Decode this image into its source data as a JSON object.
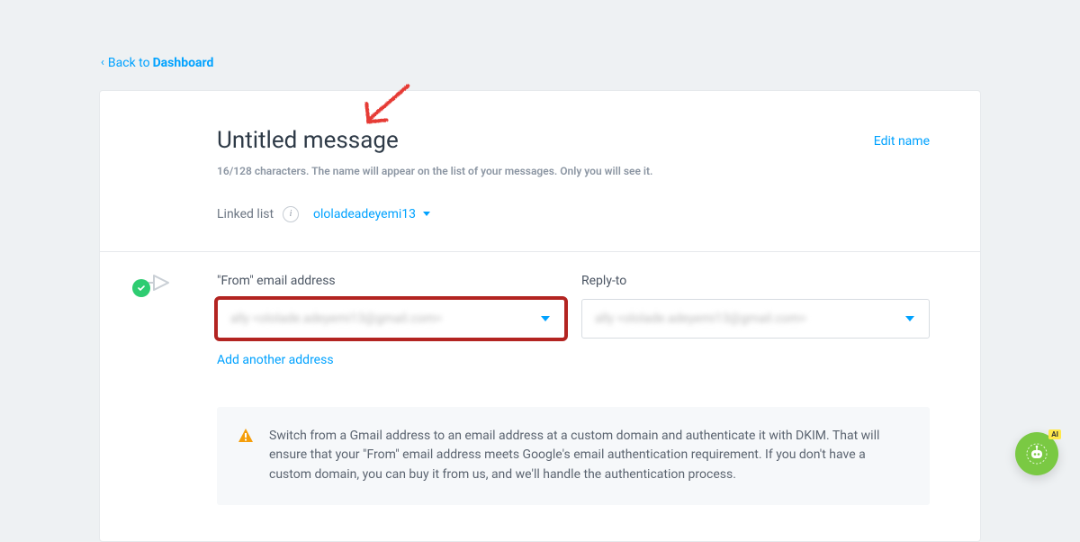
{
  "back": {
    "prefix": "Back to",
    "target": "Dashboard"
  },
  "header": {
    "title": "Untitled message",
    "subtitle": "16/128 characters. The name will appear on the list of your messages. Only you will see it.",
    "edit_name": "Edit name",
    "linked_label": "Linked list",
    "linked_value": "ololadeadeyemi13"
  },
  "fields": {
    "from_label": "\"From\" email address",
    "from_value": "ally <ololade.adeyemi13@gmail.com>",
    "replyto_label": "Reply-to",
    "replyto_value": "ally <ololade.adeyemi13@gmail.com>",
    "add_address": "Add another address"
  },
  "notice": {
    "text": "Switch from a Gmail address to an email address at a custom domain and authenticate it with DKIM. That will ensure that your \"From\" email address meets Google's email authentication requirement. If you don't have a custom domain, you can buy it from us, and we'll handle the authentication process."
  },
  "chat": {
    "ai_badge": "AI"
  }
}
